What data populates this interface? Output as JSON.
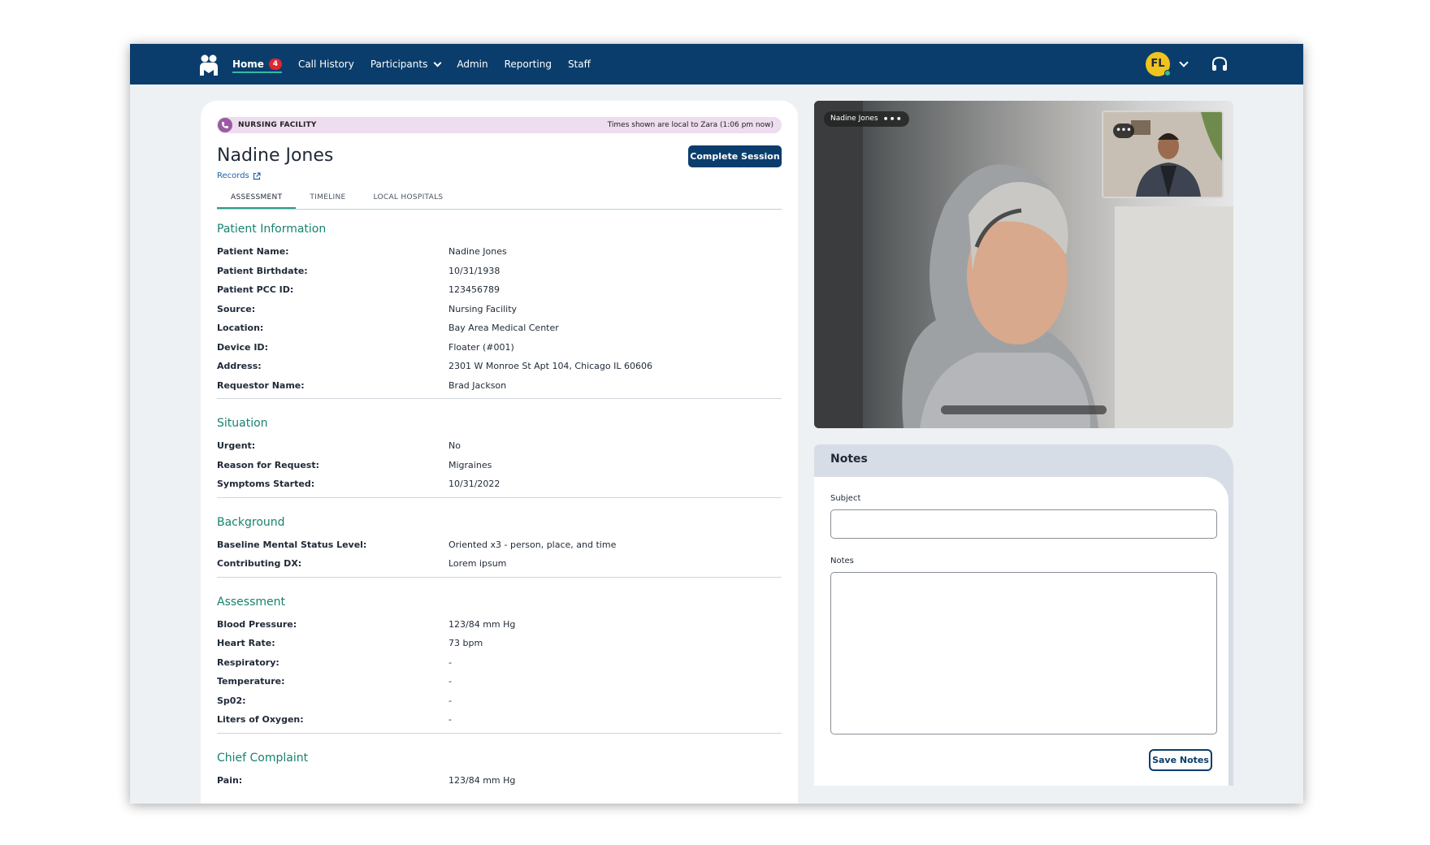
{
  "nav": {
    "items": [
      {
        "label": "Home",
        "badge": "4"
      },
      {
        "label": "Call History"
      },
      {
        "label": "Participants"
      },
      {
        "label": "Admin"
      },
      {
        "label": "Reporting"
      },
      {
        "label": "Staff"
      }
    ],
    "user_initials": "FL"
  },
  "banner": {
    "source": "NURSING FACILITY",
    "time_note": "Times shown are local to Zara (1:06 pm now)"
  },
  "patient": {
    "name": "Nadine Jones",
    "records_link": "Records"
  },
  "actions": {
    "complete_session": "Complete Session"
  },
  "tabs": [
    "ASSESSMENT",
    "TIMELINE",
    "LOCAL HOSPITALS"
  ],
  "sections": [
    {
      "title": "Patient Information",
      "rows": [
        {
          "label": "Patient Name:",
          "value": "Nadine Jones"
        },
        {
          "label": "Patient Birthdate:",
          "value": "10/31/1938"
        },
        {
          "label": "Patient PCC ID:",
          "value": "123456789"
        },
        {
          "label": "Source:",
          "value": "Nursing Facility"
        },
        {
          "label": "Location:",
          "value": "Bay Area Medical Center"
        },
        {
          "label": "Device ID:",
          "value": "Floater (#001)"
        },
        {
          "label": "Address:",
          "value": "2301 W Monroe St Apt 104, Chicago IL 60606"
        },
        {
          "label": "Requestor Name:",
          "value": "Brad Jackson"
        }
      ]
    },
    {
      "title": "Situation",
      "rows": [
        {
          "label": "Urgent:",
          "value": "No"
        },
        {
          "label": "Reason for Request:",
          "value": "Migraines"
        },
        {
          "label": "Symptoms Started:",
          "value": "10/31/2022"
        }
      ]
    },
    {
      "title": "Background",
      "rows": [
        {
          "label": "Baseline Mental Status Level:",
          "value": "Oriented x3 - person, place, and time"
        },
        {
          "label": "Contributing DX:",
          "value": "Lorem ipsum"
        }
      ]
    },
    {
      "title": "Assessment",
      "rows": [
        {
          "label": "Blood Pressure:",
          "value": "123/84 mm Hg"
        },
        {
          "label": "Heart Rate:",
          "value": "73 bpm"
        },
        {
          "label": "Respiratory:",
          "value": "-"
        },
        {
          "label": "Temperature:",
          "value": "-"
        },
        {
          "label": "Sp02:",
          "value": "-"
        },
        {
          "label": "Liters of Oxygen:",
          "value": "-"
        }
      ]
    },
    {
      "title": "Chief Complaint",
      "rows": [
        {
          "label": "Pain:",
          "value": "123/84 mm Hg"
        }
      ]
    }
  ],
  "video": {
    "participant_name": "Nadine Jones",
    "more_label": "•••"
  },
  "notes": {
    "title": "Notes",
    "subject_label": "Subject",
    "subject_value": "",
    "notes_label": "Notes",
    "notes_value": "",
    "save_label": "Save Notes"
  },
  "colors": {
    "nav_bg": "#0a3d6b",
    "accent_teal": "#17826f",
    "badge_red": "#e0262e",
    "avatar_yellow": "#f1c31e",
    "banner_purple": "#eedcef"
  }
}
